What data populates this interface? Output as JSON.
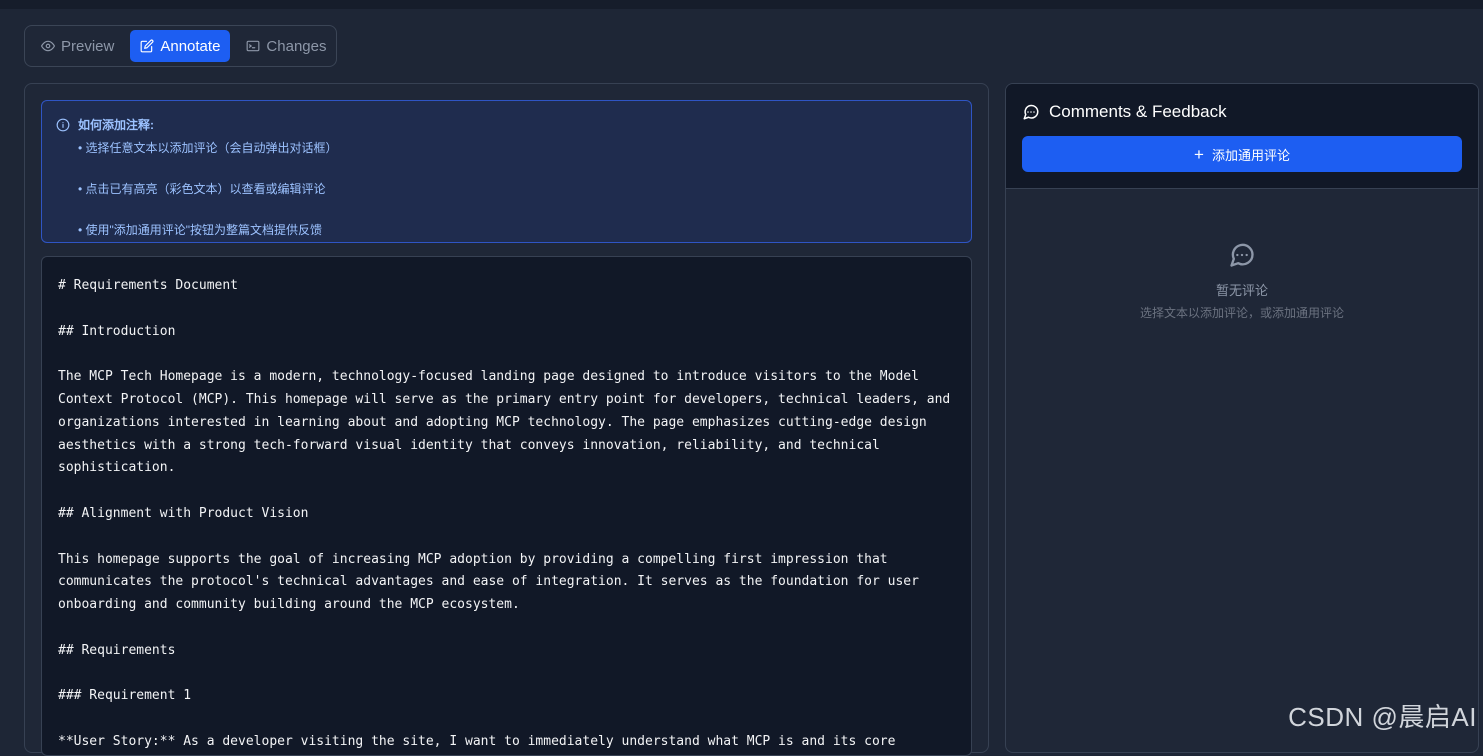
{
  "tabs": [
    {
      "label": "Preview",
      "icon": "eye-icon"
    },
    {
      "label": "Annotate",
      "icon": "edit-icon"
    },
    {
      "label": "Changes",
      "icon": "terminal-icon"
    }
  ],
  "active_tab": "Annotate",
  "info": {
    "title": "如何添加注释:",
    "items": [
      "• 选择任意文本以添加评论（会自动弹出对话框）",
      "• 点击已有高亮（彩色文本）以查看或编辑评论",
      "• 使用\"添加通用评论\"按钮为整篇文档提供反馈"
    ]
  },
  "document_lines": [
    "# Requirements Document",
    "",
    "## Introduction",
    "",
    "The MCP Tech Homepage is a modern, technology-focused landing page designed to introduce visitors to the Model",
    "Context Protocol (MCP). This homepage will serve as the primary entry point for developers, technical leaders, and",
    "organizations interested in learning about and adopting MCP technology. The page emphasizes cutting-edge design",
    "aesthetics with a strong tech-forward visual identity that conveys innovation, reliability, and technical",
    "sophistication.",
    "",
    "## Alignment with Product Vision",
    "",
    "This homepage supports the goal of increasing MCP adoption by providing a compelling first impression that",
    "communicates the protocol's technical advantages and ease of integration. It serves as the foundation for user",
    "onboarding and community building around the MCP ecosystem.",
    "",
    "## Requirements",
    "",
    "### Requirement 1",
    "",
    "**User Story:** As a developer visiting the site, I want to immediately understand what MCP is and its core"
  ],
  "comments": {
    "title": "Comments & Feedback",
    "add_button_label": "添加通用评论",
    "empty_title": "暂无评论",
    "empty_subtitle": "选择文本以添加评论，或添加通用评论"
  },
  "watermark": "CSDN @晨启AI",
  "colors": {
    "accent": "#1d5ef2",
    "background": "#1e2636",
    "editor_bg": "#111827",
    "info_text": "#9cc2ff"
  }
}
